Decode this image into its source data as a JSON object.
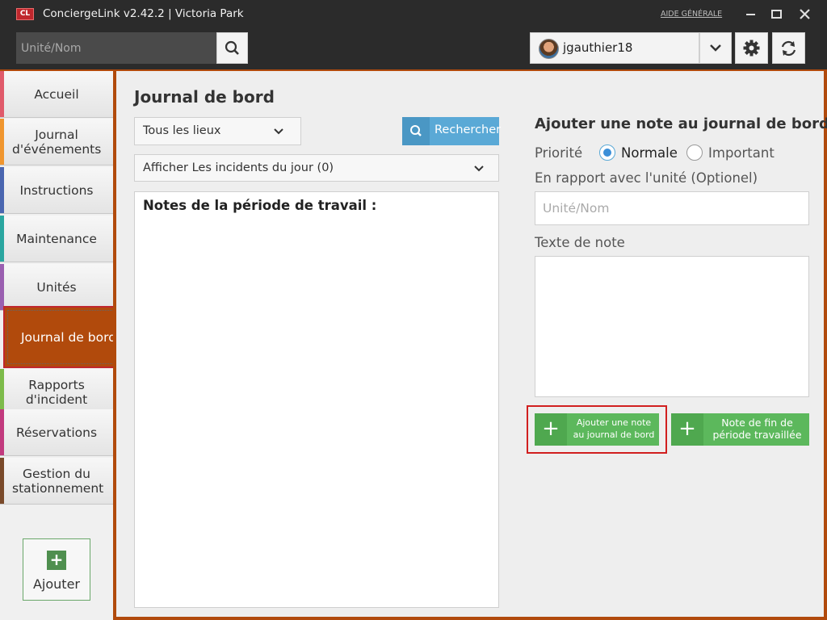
{
  "window": {
    "logo_text": "CL",
    "title": "ConciergeLink v2.42.2 | Victoria Park",
    "help_link": "AIDE GÉNÉRALE",
    "minimize_icon": "minimize-icon",
    "maximize_icon": "maximize-icon",
    "close_icon": "close-icon"
  },
  "header": {
    "search_placeholder": "Unité/Nom",
    "search_icon": "search-icon",
    "username": "jgauthier18",
    "user_dropdown_icon": "chevron-down-icon",
    "settings_icon": "gear-icon",
    "refresh_icon": "refresh-icon"
  },
  "sidebar": {
    "items": [
      {
        "label": "Accueil",
        "color": "#e05a6a"
      },
      {
        "label": "Journal d'événements",
        "color": "#f0962f"
      },
      {
        "label": "Instructions",
        "color": "#4a66b0"
      },
      {
        "label": "Maintenance",
        "color": "#2aa6a0"
      },
      {
        "label": "Unités",
        "color": "#9a5fb0"
      },
      {
        "label": "Journal de bord",
        "color": "#b14a0c"
      },
      {
        "label": "Rapports d'incident",
        "color": "#7dbb4a"
      },
      {
        "label": "Réservations",
        "color": "#c23a7e"
      },
      {
        "label": "Gestion du stationnement",
        "color": "#7a4a2a"
      }
    ],
    "active_index": 5,
    "add_button": {
      "label": "Ajouter",
      "icon": "plus-icon"
    }
  },
  "journal": {
    "title": "Journal de bord",
    "location_select": "Tous les lieux",
    "search_button": "Rechercher",
    "incidents_select": "Afficher Les incidents du jour (0)",
    "notes_title": "Notes de la période de travail :"
  },
  "form": {
    "title": "Ajouter une note au journal de bord :",
    "priority_label": "Priorité",
    "priority_options": [
      "Normale",
      "Important"
    ],
    "priority_selected": "Normale",
    "unit_label": "En rapport avec l'unité (Optionel)",
    "unit_placeholder": "Unité/Nom",
    "note_label": "Texte de note",
    "add_note_button": "Ajouter une note au journal de bord",
    "end_shift_button": "Note de fin de période travaillée"
  },
  "colors": {
    "accent": "#b14a0c",
    "primary_green": "#5cb85c",
    "search_blue": "#5aa9d6",
    "highlight_red": "#d11f1f"
  }
}
